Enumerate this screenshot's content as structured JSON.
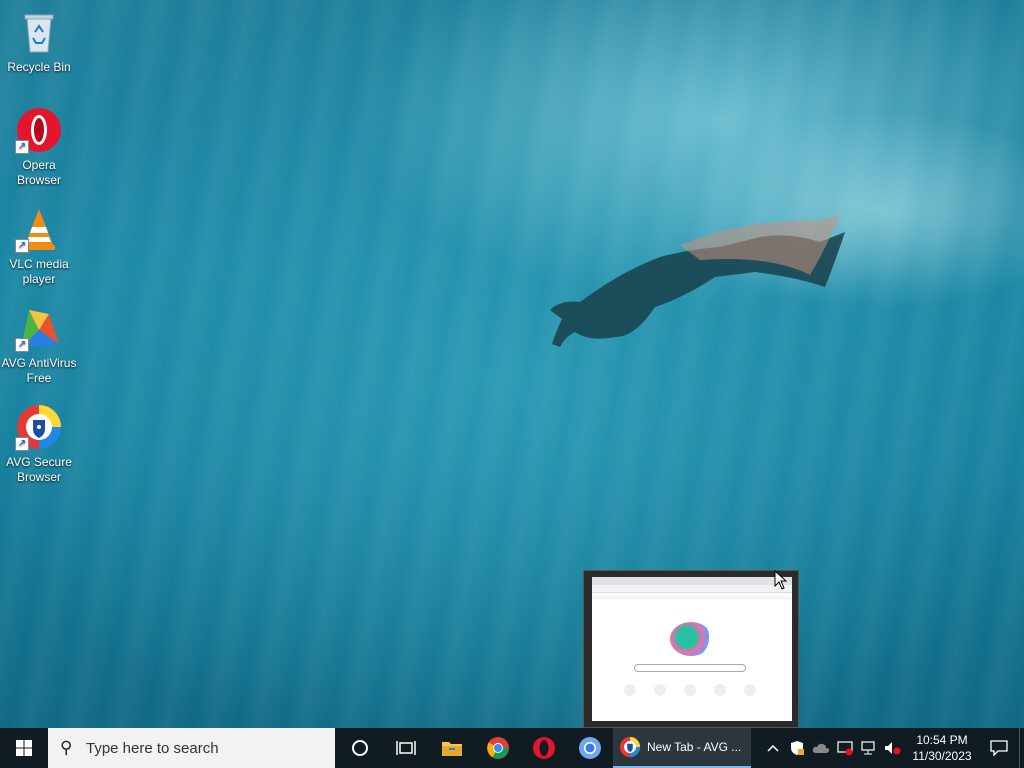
{
  "desktop": {
    "icons": [
      {
        "label": "Recycle Bin",
        "icon": "recycle-bin-icon"
      },
      {
        "label": "Opera Browser",
        "icon": "opera-icon"
      },
      {
        "label": "VLC media player",
        "icon": "vlc-icon"
      },
      {
        "label": "AVG AntiVirus Free",
        "icon": "avg-antivirus-icon"
      },
      {
        "label": "AVG Secure Browser",
        "icon": "avg-secure-browser-icon"
      }
    ]
  },
  "taskbar": {
    "search_placeholder": "Type here to search",
    "apps": [
      "cortana-icon",
      "task-view-icon",
      "file-explorer-icon",
      "chrome-icon",
      "opera-icon",
      "chromium-icon"
    ],
    "active_window": {
      "label": "New Tab - AVG ...",
      "icon": "avg-secure-browser-icon"
    },
    "tray": [
      "show-hidden-icons-icon",
      "security-icon",
      "onedrive-icon",
      "windows-update-icon",
      "network-icon",
      "volume-muted-icon"
    ],
    "time": "10:54 PM",
    "date": "11/30/2023"
  },
  "colors": {
    "taskbar": "#101b22",
    "accent": "#76b9ed"
  }
}
